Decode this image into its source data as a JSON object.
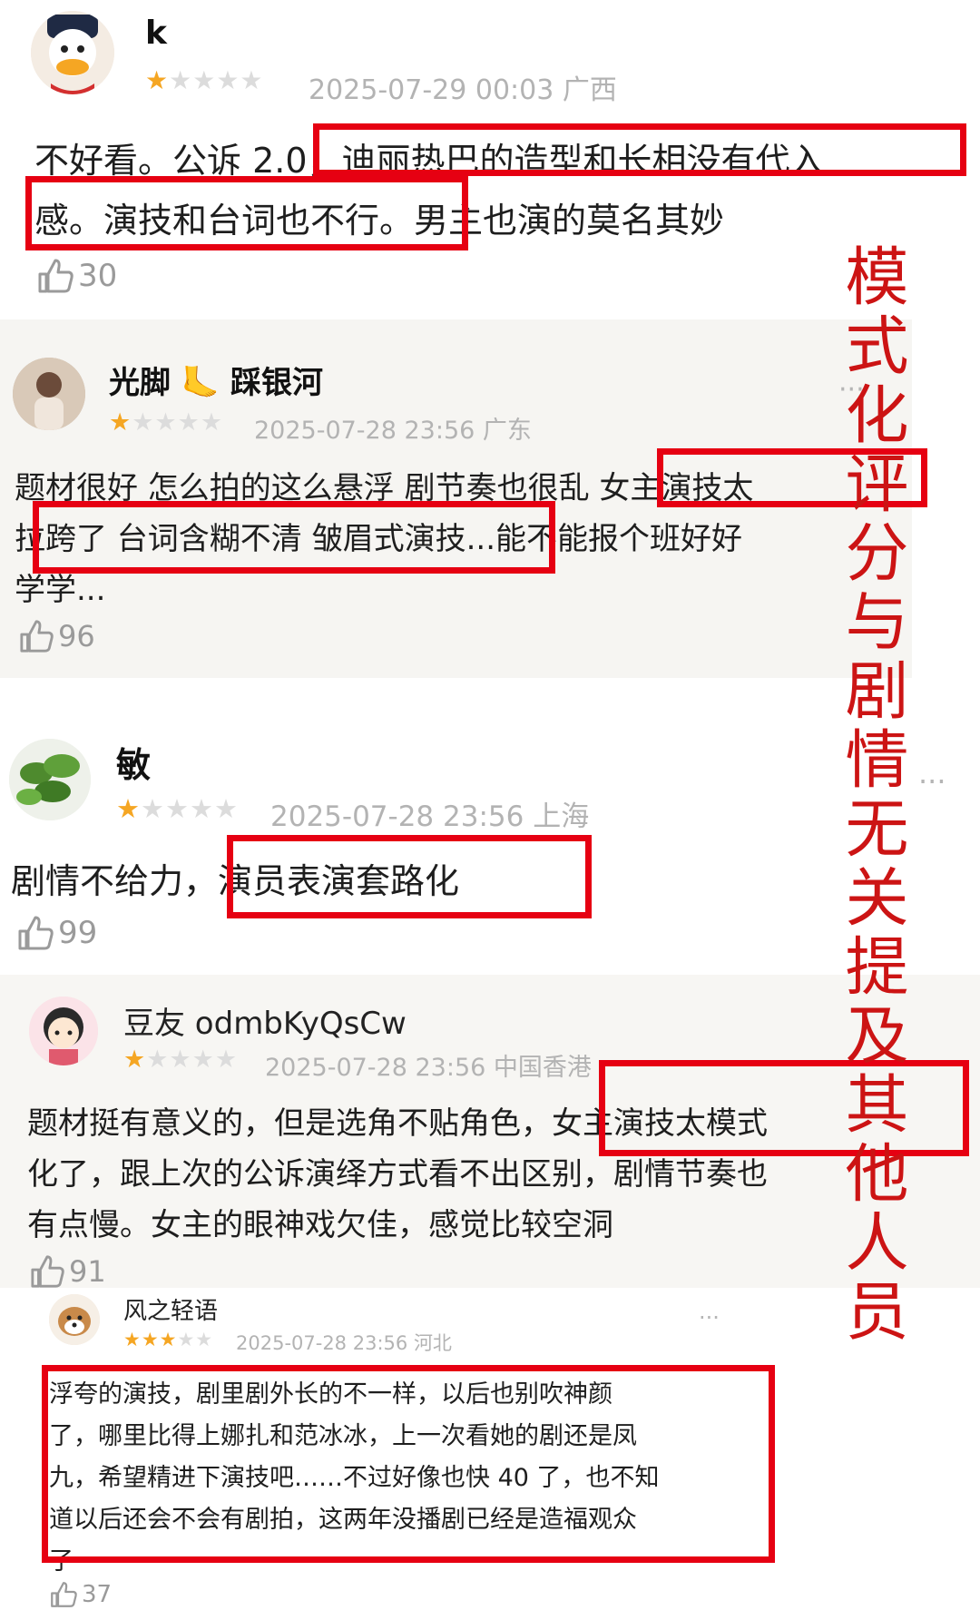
{
  "colors": {
    "annotation_red": "#e60012",
    "star_on": "#f5a623",
    "star_off": "#dcdcdc"
  },
  "reviews": [
    {
      "user": "k",
      "stars": 1,
      "time": "2025-07-29 00:03",
      "region": "广西",
      "lines": [
        "不好看。公诉 2.0，迪丽热巴的造型和长相没有代入",
        "感。演技和台词也不行。男主也演的莫名其妙"
      ],
      "likes": "30"
    },
    {
      "user": "光脚",
      "user_emoji": "🦶",
      "user_suffix": "踩银河",
      "stars": 1,
      "time": "2025-07-28 23:56",
      "region": "广东",
      "lines": [
        "题材很好 怎么拍的这么悬浮 剧节奏也很乱 女主演技太",
        "拉跨了 台词含糊不清 皱眉式演技...能不能报个班好好",
        "学学..."
      ],
      "likes": "96"
    },
    {
      "user": "敏",
      "stars": 1,
      "time": "2025-07-28 23:56",
      "region": "上海",
      "lines": [
        "剧情不给力，演员表演套路化"
      ],
      "likes": "99"
    },
    {
      "user": "豆友 odmbKyQsCw",
      "stars": 1,
      "time": "2025-07-28 23:56",
      "region": "中国香港",
      "lines": [
        "题材挺有意义的，但是选角不贴角色，女主演技太模式",
        "化了，跟上次的公诉演绎方式看不出区别，剧情节奏也",
        "有点慢。女主的眼神戏欠佳，感觉比较空洞"
      ],
      "likes": "91"
    },
    {
      "user": "风之轻语",
      "stars": 3,
      "time": "2025-07-28 23:56",
      "region": "河北",
      "lines": [
        "浮夸的演技，剧里剧外长的不一样，以后也别吹神颜",
        "了，哪里比得上娜扎和范冰冰，上一次看她的剧还是凤",
        "九，希望精进下演技吧……不过好像也快 40 了，也不知",
        "道以后还会不会有剧拍，这两年没播剧已经是造福观众",
        "了"
      ],
      "likes": "37"
    }
  ],
  "annotation_text": "模式化评分与剧情无关提及其他人员"
}
